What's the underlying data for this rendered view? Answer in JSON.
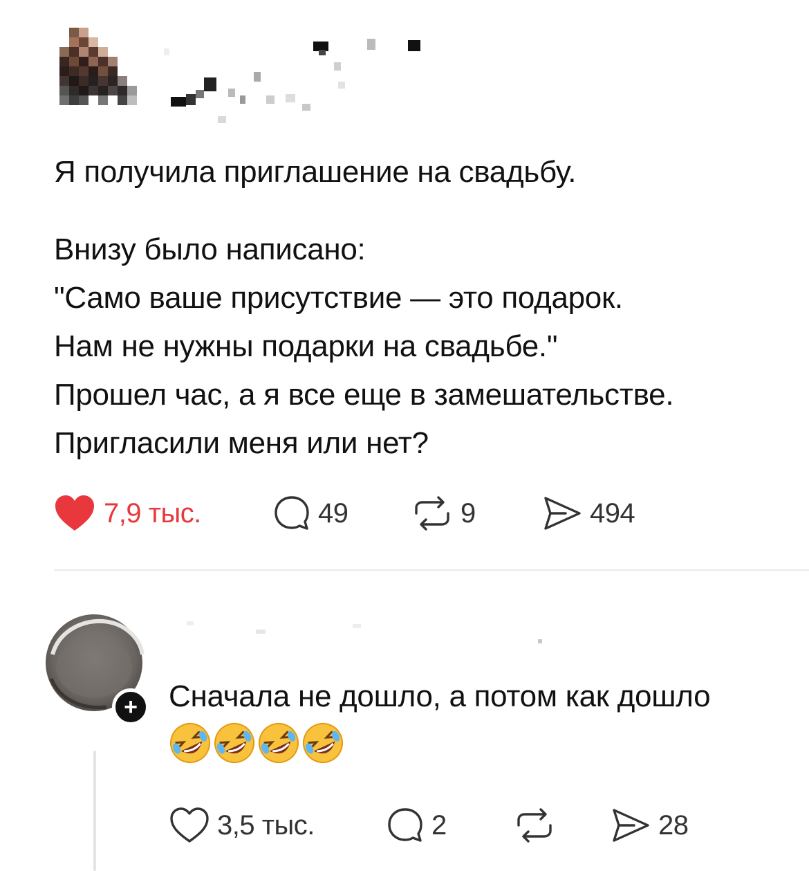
{
  "post": {
    "text_lines": [
      "Я получила приглашение на свадьбу.",
      "Внизу было написано:",
      "\"Само ваше присутствие — это подарок.",
      "Нам не нужны подарки на свадьбе.\"",
      "Прошел час, а я все еще в замешательстве.",
      "Пригласили меня или нет?"
    ],
    "likes": "7,9 тыс.",
    "replies": "49",
    "reposts": "9",
    "shares": "494",
    "liked": true
  },
  "reply": {
    "text": "Сначала не дошло, а потом как дошло",
    "emoji_name": "rolling-on-the-floor-laughing",
    "emoji_count": 4,
    "likes": "3,5 тыс.",
    "replies": "2",
    "shares": "28",
    "follow_badge": "+"
  },
  "colors": {
    "like_red": "#e8383d",
    "text": "#111111",
    "icon": "#333333",
    "divider": "#e9e9e9"
  },
  "icons": {
    "like": "heart-icon",
    "reply": "speech-bubble-icon",
    "repost": "repost-arrows-icon",
    "share": "paper-plane-icon"
  }
}
